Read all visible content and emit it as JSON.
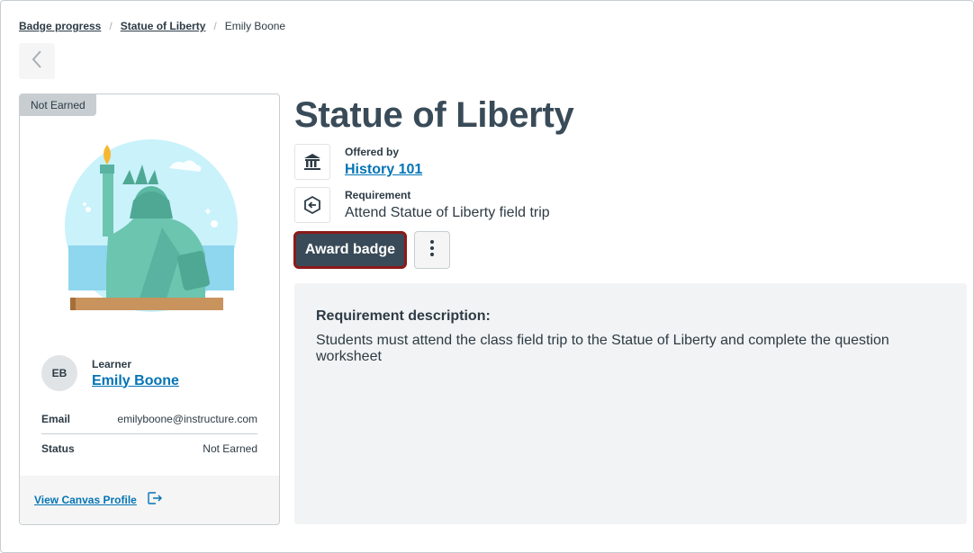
{
  "breadcrumb": {
    "items": [
      "Badge progress",
      "Statue of Liberty"
    ],
    "current": "Emily Boone"
  },
  "card": {
    "status_pill": "Not Earned",
    "learner_label": "Learner",
    "avatar_initials": "EB",
    "learner_name": "Emily Boone",
    "email_label": "Email",
    "email_value": "emilyboone@instructure.com",
    "status_label": "Status",
    "status_value": "Not Earned",
    "profile_link": "View Canvas Profile"
  },
  "badge": {
    "title": "Statue of Liberty",
    "offered_by_label": "Offered by",
    "offered_by_value": "History 101",
    "requirement_label": "Requirement",
    "requirement_value": "Attend Statue of Liberty field trip"
  },
  "actions": {
    "award_label": "Award badge"
  },
  "description": {
    "heading": "Requirement description:",
    "body": "Students must attend the class field trip to the Statue of Liberty and complete the question worksheet"
  },
  "colors": {
    "link": "#0374b5",
    "primary_button": "#394b58",
    "focus_ring": "#8b1a1a",
    "panel_bg": "#f2f3f4"
  },
  "icons": [
    "chevron-left-icon",
    "building-icon",
    "requirement-icon",
    "more-vertical-icon",
    "external-link-icon"
  ]
}
